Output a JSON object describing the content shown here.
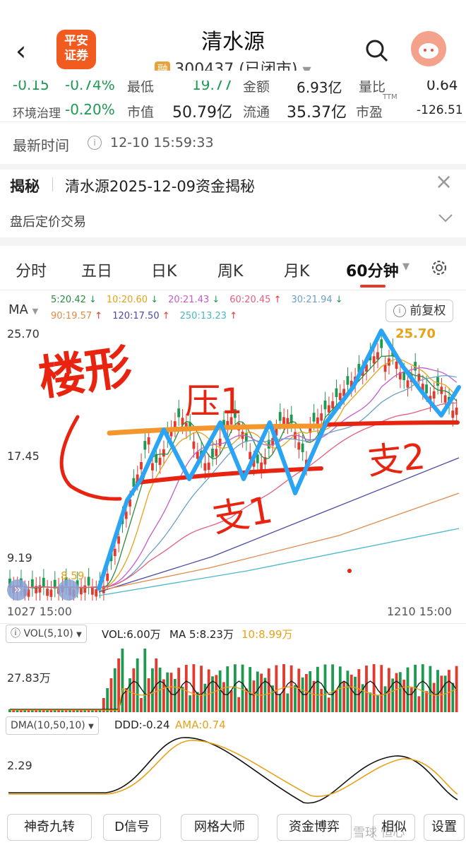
{
  "header": {
    "title": "清水源",
    "margin_badge": "融",
    "code_status": "300437 (已闭市)",
    "logo_line1": "平安",
    "logo_line2": "证券"
  },
  "quote": {
    "row1": {
      "change": "-0.15",
      "pct": "-0.74%",
      "low_label": "最低",
      "low_value": "19.77",
      "amount_label": "金额",
      "amount_value": "6.93亿",
      "ratio_label": "量比",
      "ratio_value": "0.64"
    },
    "row2": {
      "sector": "环境治理",
      "sector_pct": "-0.20%",
      "mcap_label": "市值",
      "mcap_value": "50.79亿",
      "float_label": "流通",
      "float_value": "35.37亿",
      "pe_label": "市盈",
      "pe_sup": "TTM",
      "pe_value": "-126.51"
    }
  },
  "latest": {
    "label": "最新时间",
    "time": "12-10 15:59:33"
  },
  "reveal": {
    "tag": "揭秘",
    "text": "清水源2025-12-09资金揭秘"
  },
  "after_hours": {
    "label": "盘后定价交易"
  },
  "tabs": [
    "分时",
    "五日",
    "日K",
    "周K",
    "月K",
    "60分钟"
  ],
  "ma": {
    "label": "MA",
    "rights": "前复权",
    "items_row1": [
      {
        "t": "5:20.42",
        "a": "↓",
        "c": "#2a8a3e"
      },
      {
        "t": "10:20.60",
        "a": "↓",
        "c": "#e6a21a"
      },
      {
        "t": "20:21.43",
        "a": "↓",
        "c": "#c45bc9"
      },
      {
        "t": "60:20.45",
        "a": "↑",
        "c": "#e0607e"
      },
      {
        "t": "30:21.94",
        "a": "↓",
        "c": "#6aa0c8"
      }
    ],
    "items_row2": [
      {
        "t": "90:19.57",
        "a": "↑",
        "c": "#e08a4a"
      },
      {
        "t": "120:17.50",
        "a": "↑",
        "c": "#4a4aa8"
      },
      {
        "t": "250:13.23",
        "a": "↑",
        "c": "#4ab8c8"
      }
    ]
  },
  "price_axis": {
    "top": "25.70",
    "mid": "17.45",
    "bottom": "9.19",
    "low_mark": "8.59",
    "high_mark": "25.70"
  },
  "time_axis": {
    "start": "1027 15:00",
    "end": "1210 15:00"
  },
  "annotations": {
    "pattern": "楼形",
    "resistance": "压1",
    "support1": "支1",
    "support2": "支2"
  },
  "volume": {
    "label": "VOL(5,10)",
    "vol": "VOL:6.00万",
    "ma5": "MA 5:8.23万",
    "ma10": "10:8.99万",
    "axis": "27.83万"
  },
  "dma": {
    "label": "DMA(10,50,10)",
    "ddd": "DDD:-0.24",
    "ama": "AMA:0.74",
    "axis": "2.29"
  },
  "buttons": [
    "神奇九转",
    "D信号",
    "网格大师",
    "资金博弈",
    "相似",
    "设置"
  ],
  "watermark": "雪球 恒心"
}
